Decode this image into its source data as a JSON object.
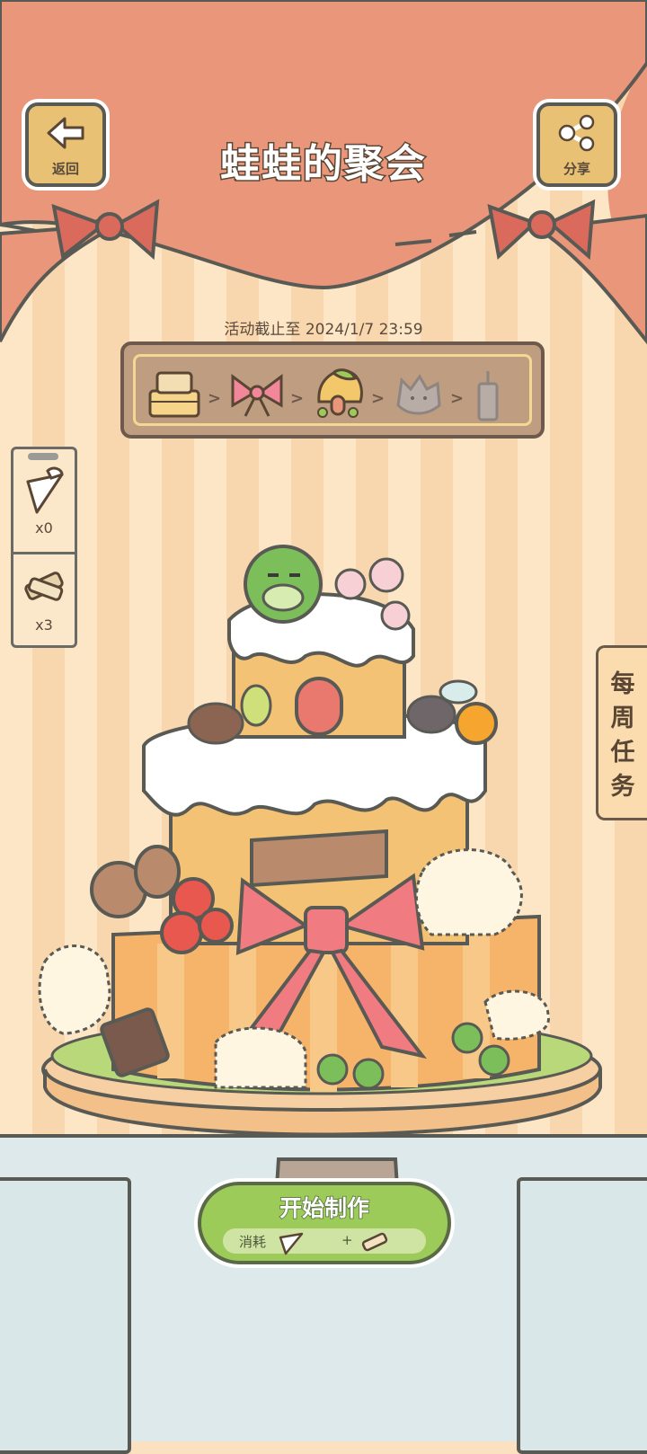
{
  "header": {
    "back_label": "返回",
    "share_label": "分享",
    "title": "蛙蛙的聚会"
  },
  "event": {
    "deadline": "活动截止至 2024/1/7 23:59",
    "stages": [
      "cake-base",
      "ribbon-bow",
      "mushroom-house",
      "cat",
      "candle"
    ],
    "current_stage_index": 2
  },
  "inventory": [
    {
      "icon": "icing-bag-icon",
      "count": "x0"
    },
    {
      "icon": "material-bundle-icon",
      "count": "x3"
    }
  ],
  "weekly_tasks": {
    "label": "每周任务"
  },
  "start_button": {
    "label": "开始制作",
    "cost_label": "消耗",
    "plus": "+"
  },
  "colors": {
    "curtain": "#e9967a",
    "bow": "#d96a5c",
    "start_green": "#9ccb5a",
    "wood": "#e9c174"
  }
}
